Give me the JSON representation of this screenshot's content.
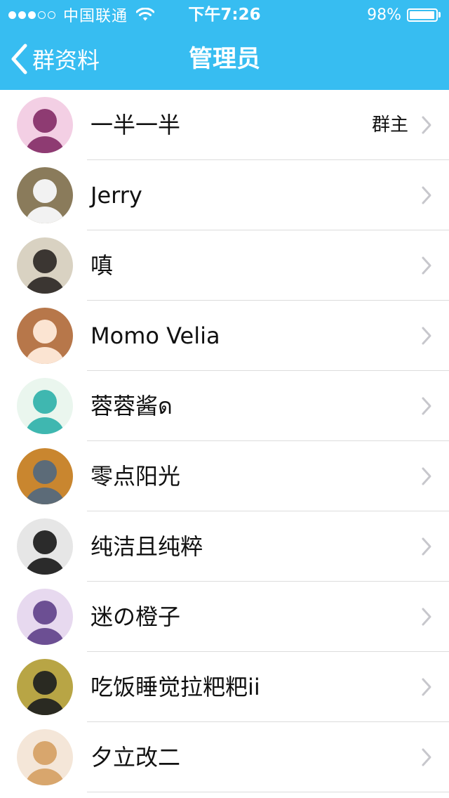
{
  "status_bar": {
    "carrier": "中国联通",
    "time": "下午7:26",
    "battery": "98%",
    "battery_level": 0.98,
    "signal_bars_filled": 3,
    "signal_bars_total": 5,
    "icons": [
      "signal-dots-icon",
      "wifi-icon",
      "battery-icon"
    ]
  },
  "nav": {
    "back_label": "群资料",
    "title": "管理员",
    "back_icon": "chevron-left-icon"
  },
  "theme": {
    "header_bg": "#37bdf1",
    "header_text": "#ffffff",
    "separator": "#dcdcdc",
    "chevron": "#c7c7cc"
  },
  "members": [
    {
      "name": "一半一半",
      "role": "群主",
      "avatar": "anime-girl-sunglasses-avatar",
      "avatar_colors": [
        "#f3cfe4",
        "#8e3b72"
      ]
    },
    {
      "name": "Jerry",
      "role": "",
      "avatar": "cat-avatar",
      "avatar_colors": [
        "#8a7b5b",
        "#f2f2f2"
      ]
    },
    {
      "name": "嗔",
      "role": "",
      "avatar": "street-photo-avatar",
      "avatar_colors": [
        "#d9d2c2",
        "#3b3632"
      ]
    },
    {
      "name": "Momo Velia",
      "role": "",
      "avatar": "anime-brown-hair-avatar",
      "avatar_colors": [
        "#b7774a",
        "#fbe4d2"
      ]
    },
    {
      "name": "蓉蓉酱ด",
      "role": "",
      "avatar": "anime-teal-hair-avatar",
      "avatar_colors": [
        "#eaf6ee",
        "#3fb7b0"
      ]
    },
    {
      "name": "零点阳光",
      "role": "",
      "avatar": "lion-avatar",
      "avatar_colors": [
        "#c9862f",
        "#5c6b78"
      ]
    },
    {
      "name": "纯洁且纯粹",
      "role": "",
      "avatar": "bw-portrait-avatar",
      "avatar_colors": [
        "#e6e6e6",
        "#2b2b2b"
      ]
    },
    {
      "name": "迷の橙子",
      "role": "",
      "avatar": "anime-purple-hair-avatar",
      "avatar_colors": [
        "#e7d9ef",
        "#6c4f93"
      ]
    },
    {
      "name": "吃饭睡觉拉粑粑ii",
      "role": "",
      "avatar": "dark-character-avatar",
      "avatar_colors": [
        "#b8a545",
        "#2a2a22"
      ]
    },
    {
      "name": "夕立改二",
      "role": "",
      "avatar": "anime-blonde-avatar",
      "avatar_colors": [
        "#f4e6d8",
        "#d8a66d"
      ]
    }
  ]
}
